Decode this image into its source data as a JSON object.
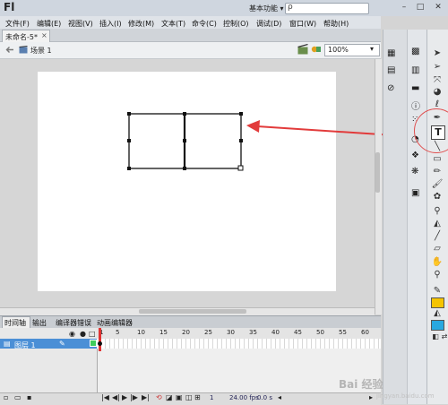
{
  "app": {
    "logo": "Fl",
    "workspace": "基本功能",
    "workspace_arrow": "▾",
    "search_icon": "ρ",
    "window_controls": [
      "–",
      "□",
      "✕"
    ]
  },
  "menu": [
    "文件(F)",
    "编辑(E)",
    "视图(V)",
    "插入(I)",
    "修改(M)",
    "文本(T)",
    "命令(C)",
    "控制(O)",
    "调试(D)",
    "窗口(W)",
    "帮助(H)"
  ],
  "document": {
    "tab_label": "未命名-5*",
    "tab_close": "×",
    "scene": "场景 1",
    "zoom": "100%"
  },
  "timeline": {
    "tabs": [
      "时间轴",
      "输出",
      "编译器错误",
      "动画编辑器"
    ],
    "layer_name": "图层 1",
    "frame_numbers": [
      "1",
      "5",
      "10",
      "15",
      "20",
      "25",
      "30",
      "35",
      "40",
      "45",
      "50",
      "55",
      "60"
    ],
    "current_frame": "1",
    "fps": "24.00 fps",
    "time": "0.0 s"
  },
  "watermark": {
    "text": "Bai 经验",
    "url": "jingyan.baidu.com"
  },
  "colors": {
    "arrow": "#e23b3b",
    "stroke_swatch": "#222222",
    "fill_swatch": "#f5c400",
    "fill2_swatch": "#29a8e0"
  }
}
